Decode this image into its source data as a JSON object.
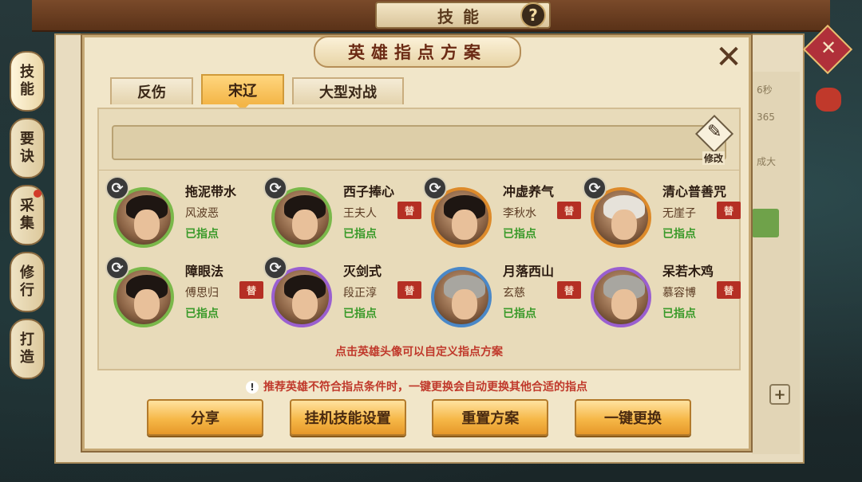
{
  "header": {
    "title": "技能",
    "help_glyph": "?"
  },
  "side_tabs": [
    {
      "label": "技\n能",
      "active": true,
      "dot": false
    },
    {
      "label": "要\n诀",
      "active": false,
      "dot": false
    },
    {
      "label": "采\n集",
      "active": false,
      "dot": true
    },
    {
      "label": "修\n行",
      "active": false,
      "dot": false
    },
    {
      "label": "打\n造",
      "active": false,
      "dot": false
    }
  ],
  "background_ghost": {
    "timer": "6秒",
    "num": "365",
    "text": "成大"
  },
  "modal": {
    "title": "英雄指点方案",
    "close_glyph": "✕",
    "tabs": [
      {
        "label": "反伤",
        "active": false
      },
      {
        "label": "宋辽",
        "active": true
      },
      {
        "label": "大型对战",
        "active": false
      }
    ],
    "name_field_value": "",
    "edit_label": "修改",
    "heroes": [
      {
        "skill": "拖泥带水",
        "name": "风波恶",
        "status": "已指点",
        "ring": "green",
        "swap": true,
        "stamp": ""
      },
      {
        "skill": "西子捧心",
        "name": "王夫人",
        "status": "已指点",
        "ring": "green",
        "swap": true,
        "stamp": "替"
      },
      {
        "skill": "冲虚养气",
        "name": "李秋水",
        "status": "已指点",
        "ring": "orange",
        "swap": true,
        "stamp": "替"
      },
      {
        "skill": "清心普善咒",
        "name": "无崖子",
        "status": "已指点",
        "ring": "orange",
        "swap": true,
        "stamp": "替"
      },
      {
        "skill": "障眼法",
        "name": "傅思归",
        "status": "已指点",
        "ring": "green",
        "swap": true,
        "stamp": "替"
      },
      {
        "skill": "灭剑式",
        "name": "段正淳",
        "status": "已指点",
        "ring": "purple",
        "swap": true,
        "stamp": "替"
      },
      {
        "skill": "月落西山",
        "name": "玄慈",
        "status": "已指点",
        "ring": "blue",
        "swap": false,
        "stamp": "替"
      },
      {
        "skill": "呆若木鸡",
        "name": "慕容博",
        "status": "已指点",
        "ring": "purple",
        "swap": false,
        "stamp": "替"
      }
    ],
    "hint": "点击英雄头像可以自定义指点方案",
    "warning": "推荐英雄不符合指点条件时，一键更换会自动更换其他合适的指点",
    "buttons": {
      "share": "分享",
      "idle_skill": "挂机技能设置",
      "reset": "重置方案",
      "replace_all": "一键更换"
    }
  }
}
